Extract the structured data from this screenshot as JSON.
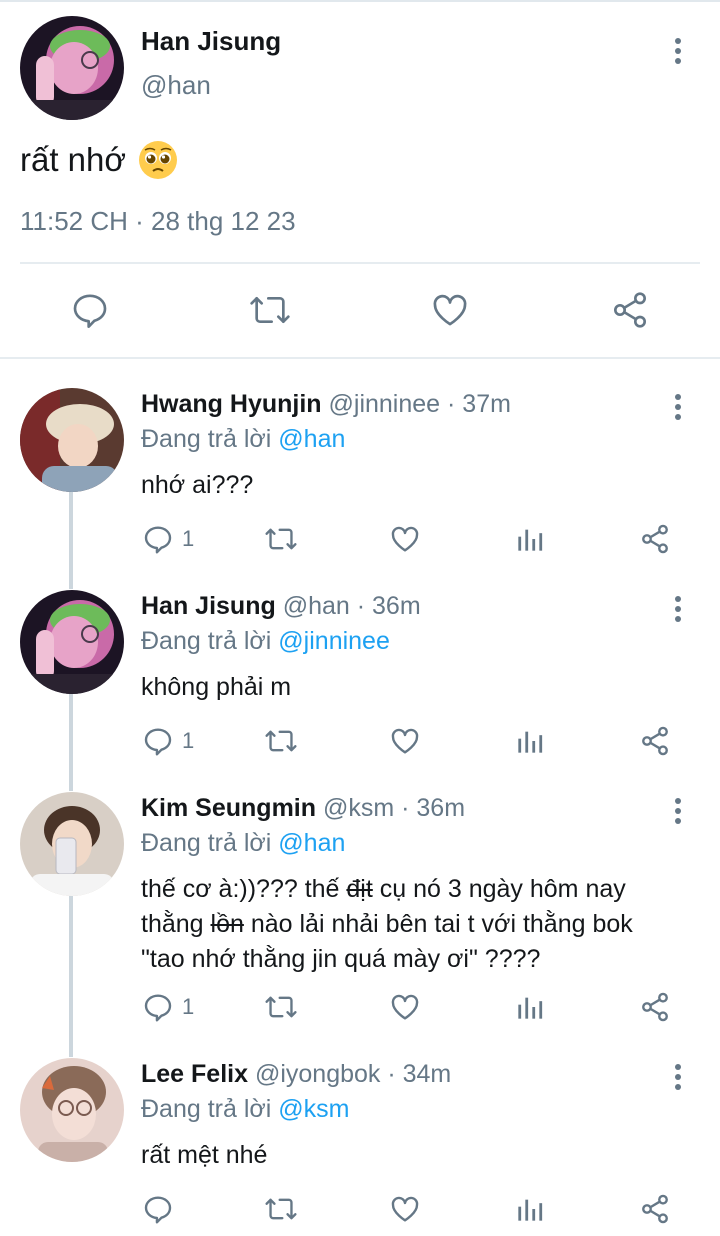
{
  "main_tweet": {
    "name": "Han Jisung",
    "handle": "@han",
    "text": "rất nhớ",
    "emoji": "🥺",
    "timestamp": "11:52 CH · 28 thg 12 23"
  },
  "replying_prefix": "Đang trả lời",
  "replies": [
    {
      "name": "Hwang Hyunjin",
      "meta": "@jinninee · 37m",
      "replying_to": "@han",
      "text": "nhớ ai???",
      "reply_count": "1"
    },
    {
      "name": "Han Jisung",
      "meta": "@han · 36m",
      "replying_to": "@jinninee",
      "text": "không phải m",
      "reply_count": "1"
    },
    {
      "name": "Kim Seungmin",
      "meta": "@ksm · 36m",
      "replying_to": "@han",
      "text_parts": {
        "a": "thế cơ à:))??? thế ",
        "b": "địt",
        "c": " cụ nó 3 ngày hôm nay",
        "d": "thằng ",
        "e": "lồn",
        "f": " nào lải nhải bên tai t với thằng bok",
        "g": "\"tao nhớ thằng jin quá mày ơi\" ????"
      },
      "reply_count": "1"
    },
    {
      "name": "Lee Felix",
      "meta": "@iyongbok · 34m",
      "replying_to": "@ksm",
      "text": "rất mệt nhé",
      "reply_count": ""
    }
  ],
  "icons": {
    "reply": "reply-icon",
    "retweet": "retweet-icon",
    "like": "heart-icon",
    "analytics": "analytics-icon",
    "share": "share-icon",
    "more": "more-vertical-icon"
  },
  "colors": {
    "link": "#1da1f2",
    "secondary_text": "#657786",
    "thread_line": "#ccd6dd"
  }
}
